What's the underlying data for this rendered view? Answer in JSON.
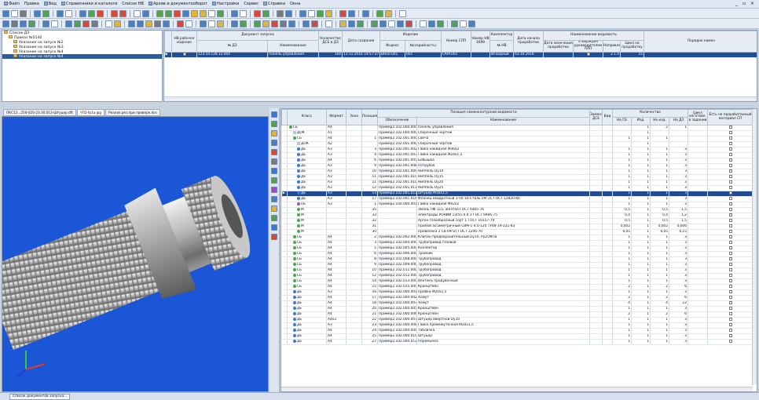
{
  "menubar": {
    "items": [
      "Файл",
      "Правка",
      "Вид",
      "Справочники и каталоги",
      "Список НВ",
      "Архив и документооборот",
      "Настройки",
      "Сервис",
      "Справка",
      "Окна"
    ]
  },
  "window_controls": "_ ▫ ×",
  "tree": {
    "items": [
      {
        "label": "Список ДЗ"
      },
      {
        "label": "Приказ №5140"
      },
      {
        "label": "Указание на запуск №2"
      },
      {
        "label": "Указание на запуск №3"
      },
      {
        "label": "Указание на запуск №4"
      },
      {
        "label": "Указание на запуск №4"
      }
    ]
  },
  "top_table": {
    "headers": {
      "nv": "НВ рабочее изделие",
      "doc": "Документ запуска",
      "doc_no": "№ ДЗ",
      "doc_name": "Наименование",
      "qty": "Количество ДСЕ в ДЗ",
      "date": "Дата создания",
      "product": "Изделие",
      "index": "Индекс",
      "nn": "№(серийность)",
      "spp": "Номер СПП",
      "nv1": "Номер НВ 1699",
      "kompl": "Комплектор",
      "nn2": "№ НВ",
      "vedom": "Дата начала проработки",
      "title": "Наименование ведомость",
      "date_vych": "Дата окончания проработки",
      "utv": "Утвержден руководителем ПЛП",
      "napr": "Направлено",
      "cikl": "Цикл на проработку",
      "porad": "Порядок намен"
    },
    "row": {
      "doc_no": "123.14.128.15.004",
      "doc_name": "Панель управления",
      "qty": "164",
      "date": "13.11.2016 19:57:37",
      "index": "ВН10.001",
      "nn": "001",
      "spp": "СКМ.001",
      "nn2": "Исходный",
      "vedom": "03.10.2016",
      "napr": "2.1.4",
      "cikl": "15"
    }
  },
  "viewer_tabs": [
    "ПКС12...250-020-23.30.013-Штуцер.dft",
    "ЧП2-fp1a.jpg",
    "Реализ.рез.при проверк.doc"
  ],
  "grid": {
    "headers": {
      "klass": "Класс",
      "format": "Формат",
      "zona": "Зона",
      "poz": "Позиция",
      "group": "Позиция номенклатурной ведомости",
      "obozn": "Обозначение",
      "naim": "Наименование",
      "zam": "Заменяет ДСЕ",
      "vid": "Вид",
      "qty_group": "Количество",
      "na_sb": "На СБ",
      "izd": "Изд.",
      "na_izd": "На изд.",
      "na_dz": "На ДЗ",
      "cena": "Цикл изготовл. в задании",
      "est": "Есть не проработанный материал СП"
    },
    "rows": [
      {
        "lvl": 0,
        "klass": "СБ",
        "format": "А4",
        "poz": "",
        "obozn": "Пример2.102.000.000",
        "naim": "Панель управления",
        "na_sb": "",
        "izd": "1",
        "na_izd": "2",
        "na_dz": "1",
        "sel": false
      },
      {
        "lvl": 1,
        "klass": "ДОК",
        "format": "А1",
        "poz": "",
        "obozn": "Пример2.102.000.000СБ",
        "naim": "Сборочный чертеж",
        "na_sb": "",
        "izd": "1",
        "na_izd": "",
        "na_dz": "",
        "sel": false
      },
      {
        "lvl": 1,
        "klass": "СБ",
        "format": "А4",
        "poz": "1",
        "obozn": "Пример2.102.001.000",
        "naim": "Свеча",
        "na_sb": "1",
        "izd": "1",
        "na_izd": "1",
        "na_dz": "",
        "sel": false
      },
      {
        "lvl": 2,
        "klass": "ДОК",
        "format": "А2",
        "poz": "",
        "obozn": "Пример2.102.001.000СБ",
        "naim": "Сборочный чертеж",
        "na_sb": "",
        "izd": "1",
        "na_izd": "",
        "na_dz": "",
        "sel": false
      },
      {
        "lvl": 2,
        "klass": "ДЕ",
        "format": "А3",
        "poz": "3",
        "obozn": "Пример2.102.001.002",
        "naim": "Гайка накидная М36х2",
        "na_sb": "1",
        "izd": "1",
        "na_izd": "1",
        "na_dz": "3",
        "sel": false
      },
      {
        "lvl": 2,
        "klass": "ДЕ",
        "format": "А3",
        "poz": "4",
        "obozn": "Пример2.102.001.003",
        "naim": "Гайка накидная М24х1,5",
        "na_sb": "1",
        "izd": "1",
        "na_izd": "1",
        "na_dz": "3",
        "sel": false
      },
      {
        "lvl": 2,
        "klass": "ДЕ",
        "format": "А4",
        "poz": "6",
        "obozn": "Пример2.102.001.005",
        "naim": "Бобышка",
        "na_sb": "1",
        "izd": "1",
        "na_izd": "1",
        "na_dz": "3",
        "sel": false
      },
      {
        "lvl": 2,
        "klass": "ДЕ",
        "format": "А3",
        "poz": "9",
        "obozn": "Пример2.102.001.008",
        "naim": "Патрубок",
        "na_sb": "1",
        "izd": "1",
        "na_izd": "1",
        "na_dz": "3",
        "sel": false
      },
      {
        "lvl": 2,
        "klass": "ДЕ",
        "format": "А3",
        "poz": "10",
        "obozn": "Пример2.102.001.009",
        "naim": "Ниппель Dy10",
        "na_sb": "1",
        "izd": "1",
        "na_izd": "1",
        "na_dz": "3",
        "sel": false
      },
      {
        "lvl": 2,
        "klass": "ДЕ",
        "format": "А3",
        "poz": "11",
        "obozn": "Пример2.102.001.010",
        "naim": "Ниппель Dy15",
        "na_sb": "1",
        "izd": "1",
        "na_izd": "1",
        "na_dz": "3",
        "sel": false
      },
      {
        "lvl": 2,
        "klass": "ДЕ",
        "format": "А3",
        "poz": "11",
        "obozn": "Пример2.102.001.010",
        "naim": "Ниппель Dy20",
        "na_sb": "1",
        "izd": "1",
        "na_izd": "1",
        "na_dz": "3",
        "sel": false
      },
      {
        "lvl": 2,
        "klass": "ДЕ",
        "format": "А3",
        "poz": "12",
        "obozn": "Пример2.102.001.011",
        "naim": "Ниппель Dy25",
        "na_sb": "1",
        "izd": "1",
        "na_izd": "1",
        "na_dz": "3",
        "sel": false
      },
      {
        "lvl": 2,
        "klass": "ДЕ",
        "format": "А3",
        "poz": "13",
        "obozn": "Пример2.102.001.012",
        "naim": "Штуцер М16х1,5",
        "na_sb": "1",
        "izd": "1",
        "na_izd": "1",
        "na_dz": "3",
        "sel": true
      },
      {
        "lvl": 2,
        "klass": "ДЕ",
        "format": "А3",
        "poz": "17",
        "obozn": "Пример2.102.001.016",
        "naim": "Фланец квадратный 3-50-16-Сталь 09Г2С ГОСТ 12820-80",
        "na_sb": "1",
        "izd": "1",
        "na_izd": "1",
        "na_dz": "3",
        "sel": false
      },
      {
        "lvl": 2,
        "klass": "ПЕ",
        "format": "А3",
        "poz": "1",
        "obozn": "Пример2.100.000.001",
        "naim": "Гайка накидная М42х2",
        "na_sb": "1",
        "izd": "1",
        "na_izd": "1",
        "na_dz": "3",
        "sel": false
      },
      {
        "lvl": 2,
        "klass": "М",
        "format": "",
        "poz": "35",
        "obozn": "",
        "naim": "Эмаль ПФ 115, желтая ГОСТ 6465-76",
        "na_sb": "0,5",
        "izd": "1",
        "na_izd": "0,5",
        "na_dz": "1,5",
        "sel": false
      },
      {
        "lvl": 2,
        "klass": "М",
        "format": "",
        "poz": "33",
        "obozn": "",
        "naim": "Электроды УОНИИ 13/55-4.0-1 ГОСТ 9466-75",
        "na_sb": "0,4",
        "izd": "1",
        "na_izd": "0,4",
        "na_dz": "1,2",
        "sel": false
      },
      {
        "lvl": 2,
        "klass": "М",
        "format": "",
        "poz": "32",
        "obozn": "",
        "naim": "Аргон газообразный сорт 1 ГОСТ 10157-79",
        "na_sb": "0,5",
        "izd": "1",
        "na_izd": "0,5",
        "na_dz": "1,5",
        "sel": false
      },
      {
        "lvl": 2,
        "klass": "М",
        "format": "",
        "poz": "31",
        "obozn": "",
        "naim": "Припой ассиметричный СВМ-1-4.0-120 ТУ48-19-221-83",
        "na_sb": "0,002",
        "izd": "1",
        "na_izd": "0,002",
        "na_dz": "0,006",
        "sel": false
      },
      {
        "lvl": 2,
        "klass": "М",
        "format": "",
        "poz": "30",
        "obozn": "",
        "naim": "Проволока 2 Св-09г2с ГОСТ 2246-70",
        "na_sb": "0,05",
        "izd": "1",
        "na_izd": "0,05",
        "na_dz": "0,15",
        "sel": false
      },
      {
        "lvl": 1,
        "klass": "СБ",
        "format": "А4",
        "poz": "2",
        "obozn": "Пример2.102.002.000",
        "naim": "Клапан предохранительный Dy10, Ру25МПа",
        "na_sb": "1",
        "izd": "1",
        "na_izd": "1",
        "na_dz": "3",
        "sel": false
      },
      {
        "lvl": 1,
        "klass": "СБ",
        "format": "А4",
        "poz": "3",
        "obozn": "Пример2.102.004.000",
        "naim": "Трубопровод газовой",
        "na_sb": "1",
        "izd": "1",
        "na_izd": "1",
        "na_dz": "3",
        "sel": false
      },
      {
        "lvl": 1,
        "klass": "СБ",
        "format": "А4",
        "poz": "5",
        "obozn": "Пример2.102.005.000",
        "naim": "Коллектор",
        "na_sb": "1",
        "izd": "1",
        "na_izd": "1",
        "na_dz": "3",
        "sel": false
      },
      {
        "lvl": 1,
        "klass": "СБ",
        "format": "А4",
        "poz": "6",
        "obozn": "Пример2.102.006.000",
        "naim": "Тройник",
        "na_sb": "1",
        "izd": "1",
        "na_izd": "1",
        "na_dz": "3",
        "sel": false
      },
      {
        "lvl": 1,
        "klass": "СБ",
        "format": "А4",
        "poz": "8",
        "obozn": "Пример2.102.008.000",
        "naim": "Трубопровод",
        "na_sb": "1",
        "izd": "1",
        "na_izd": "1",
        "na_dz": "3",
        "sel": false
      },
      {
        "lvl": 1,
        "klass": "СБ",
        "format": "А4",
        "poz": "9",
        "obozn": "Пример2.102.009.000",
        "naim": "Трубопровод",
        "na_sb": "1",
        "izd": "1",
        "na_izd": "1",
        "na_dz": "3",
        "sel": false
      },
      {
        "lvl": 1,
        "klass": "СБ",
        "format": "А4",
        "poz": "10",
        "obozn": "Пример2.102.011.000",
        "naim": "Трубопровод",
        "na_sb": "1",
        "izd": "1",
        "na_izd": "1",
        "na_dz": "3",
        "sel": false
      },
      {
        "lvl": 1,
        "klass": "СБ",
        "format": "А4",
        "poz": "12",
        "obozn": "Пример2.102.012.000",
        "naim": "Трубопровод",
        "na_sb": "1",
        "izd": "1",
        "na_izd": "1",
        "na_dz": "3",
        "sel": false
      },
      {
        "lvl": 1,
        "klass": "СБ",
        "format": "А4",
        "poz": "14",
        "obozn": "Пример2.102.013.000",
        "naim": "Вентиль продувочный",
        "na_sb": "1",
        "izd": "1",
        "na_izd": "1",
        "na_dz": "3",
        "sel": false
      },
      {
        "lvl": 1,
        "klass": "СБ",
        "format": "А4",
        "poz": "15",
        "obozn": "Пример2.102.015.000",
        "naim": "Кронштейн",
        "na_sb": "2",
        "izd": "1",
        "na_izd": "2",
        "na_dz": "6",
        "sel": false
      },
      {
        "lvl": 1,
        "klass": "ДЕ",
        "format": "А3",
        "poz": "16",
        "obozn": "Пример2.102.000.001",
        "naim": "Пробка М20х1,5",
        "na_sb": "1",
        "izd": "1",
        "na_izd": "1",
        "na_dz": "3",
        "sel": false
      },
      {
        "lvl": 1,
        "klass": "ДЕ",
        "format": "А4",
        "poz": "17",
        "obozn": "Пример2.102.000.002",
        "naim": "Хомут",
        "na_sb": "2",
        "izd": "1",
        "na_izd": "2",
        "na_dz": "6",
        "sel": false
      },
      {
        "lvl": 1,
        "klass": "ДЕ",
        "format": "А4",
        "poz": "18",
        "obozn": "Пример2.102.000.003",
        "naim": "Хомут",
        "na_sb": "4",
        "izd": "1",
        "na_izd": "4",
        "na_dz": "12",
        "sel": false
      },
      {
        "lvl": 1,
        "klass": "ДЕ",
        "format": "А4",
        "poz": "20",
        "obozn": "Пример2.102.000.005",
        "naim": "Кронштейн",
        "na_sb": "1",
        "izd": "1",
        "na_izd": "1",
        "na_dz": "3",
        "sel": false
      },
      {
        "lvl": 1,
        "klass": "ДЕ",
        "format": "А4",
        "poz": "21",
        "obozn": "Пример2.102.000.006",
        "naim": "Кронштейн",
        "na_sb": "2",
        "izd": "1",
        "na_izd": "2",
        "na_dz": "6",
        "sel": false
      },
      {
        "lvl": 1,
        "klass": "ДЕ",
        "format": "А4х3",
        "poz": "22",
        "obozn": "Пример2.102.000.007",
        "naim": "Штуцер ввертной Dy10",
        "na_sb": "1",
        "izd": "1",
        "na_izd": "1",
        "na_dz": "3",
        "sel": false
      },
      {
        "lvl": 1,
        "klass": "ДЕ",
        "format": "А3",
        "poz": "23",
        "obozn": "Пример2.102.000.008",
        "naim": "Гайка промежуточная М20х1,5",
        "na_sb": "1",
        "izd": "1",
        "na_izd": "1",
        "na_dz": "3",
        "sel": false
      },
      {
        "lvl": 1,
        "klass": "ДЕ",
        "format": "А4",
        "poz": "24",
        "obozn": "Пример2.102.000.009",
        "naim": "Табличка",
        "na_sb": "1",
        "izd": "1",
        "na_izd": "1",
        "na_dz": "3",
        "sel": false
      },
      {
        "lvl": 1,
        "klass": "ДЕ",
        "format": "А4",
        "poz": "25",
        "obozn": "Пример2.102.000.010",
        "naim": "Штуцер",
        "na_sb": "1",
        "izd": "1",
        "na_izd": "1",
        "na_dz": "3",
        "sel": false
      },
      {
        "lvl": 1,
        "klass": "ДЕ",
        "format": "А4",
        "poz": "27",
        "obozn": "Пример2.102.000.012",
        "naim": "Перемычка",
        "na_sb": "1",
        "izd": "1",
        "na_izd": "1",
        "na_dz": "3",
        "sel": false
      }
    ]
  },
  "status": {
    "tab_label": "Список документов запуска..."
  },
  "colors": {
    "selection": "#1e4d96",
    "viewport_bg": "#1a56d6",
    "window_bg": "#c9d3e0"
  }
}
